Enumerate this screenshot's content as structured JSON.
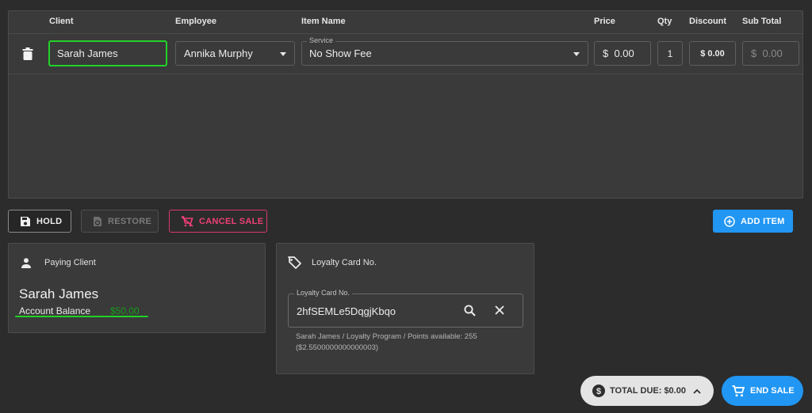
{
  "table": {
    "headers": {
      "client": "Client",
      "employee": "Employee",
      "item_name": "Item Name",
      "price": "Price",
      "qty": "Qty",
      "discount": "Discount",
      "sub_total": "Sub Total"
    },
    "row": {
      "client": "Sarah James",
      "employee": "Annika Murphy",
      "service_legend": "Service",
      "service": "No Show Fee",
      "price": "$  0.00",
      "qty": "1",
      "discount": "$ 0.00",
      "sub_total": "$  0.00"
    }
  },
  "actions": {
    "hold": "HOLD",
    "restore": "RESTORE",
    "cancel_sale": "CANCEL SALE",
    "add_item": "ADD ITEM"
  },
  "paying_client": {
    "title": "Paying Client",
    "name": "Sarah James",
    "balance_label": "Account Balance",
    "balance_value": "$50.00"
  },
  "loyalty": {
    "title": "Loyalty Card No.",
    "field_legend": "Loyalty Card No.",
    "field_value": "2hfSEMLe5DqgjKbqo",
    "info_line1": "Sarah James / Loyalty Program / Points available: 255",
    "info_line2": "($2.5500000000000003)"
  },
  "footer": {
    "total_due": "TOTAL DUE: $0.00",
    "end_sale": "END SALE"
  },
  "colors": {
    "accent": "#2196f3",
    "danger": "#ef3f76",
    "highlight": "#22d22a",
    "balance": "#129e17"
  }
}
